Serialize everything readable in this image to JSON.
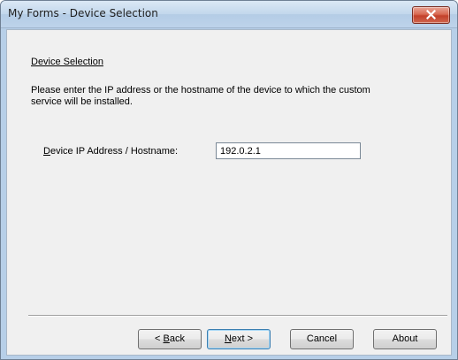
{
  "window": {
    "title": "My Forms - Device Selection",
    "close_icon": "close-icon"
  },
  "content": {
    "section_heading": "Device Selection",
    "description_line1": "Please enter the IP address or the hostname of the device to which the custom",
    "description_line2": "service will be installed.",
    "ip_label_mnemonic": "D",
    "ip_label_rest": "evice IP Address / Hostname:",
    "ip_value": "192.0.2.1"
  },
  "buttons": {
    "back_prefix": "< ",
    "back_mnemonic": "B",
    "back_rest": "ack",
    "next_mnemonic": "N",
    "next_rest": "ext >",
    "cancel": "Cancel",
    "about": "About"
  },
  "colors": {
    "title_bar": "#c2d7ec",
    "close_button": "#d0563f",
    "dialog_background": "#f0f0f0",
    "default_button_border": "#3c7fb1"
  }
}
